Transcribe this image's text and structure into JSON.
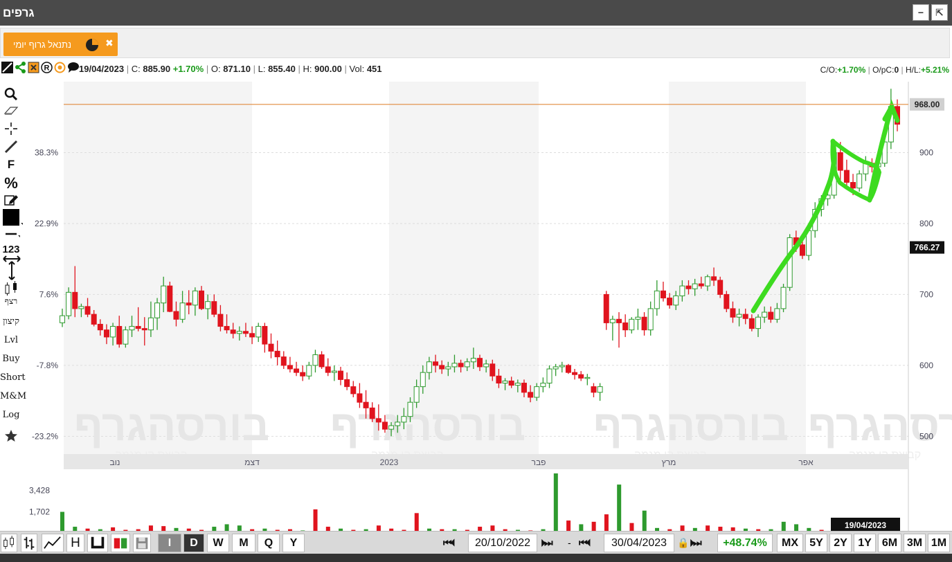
{
  "window": {
    "title": "גרפים",
    "minimize": "−",
    "popout": "⇱"
  },
  "tab": {
    "label": "נתנאל גרוף יומי",
    "icon": "pie-chart-icon",
    "close": "✖"
  },
  "info": {
    "date": "19/04/2023",
    "close_label": "C:",
    "close": "885.90",
    "change": "+1.70%",
    "open_label": "O:",
    "open": "871.10",
    "low_label": "L:",
    "low": "855.40",
    "high_label": "H:",
    "high": "900.00",
    "vol_label": "Vol:",
    "vol": "451",
    "co_label": "C/O:",
    "co": "+1.70%",
    "opc_label": "O/pC:",
    "opc": "0",
    "hl_label": "H/L:",
    "hl": "+5.21%"
  },
  "left_tools": {
    "text_f": "F",
    "percent": "%",
    "numbers": "123",
    "rescale": "רצף",
    "kitzon": "קיצון",
    "lvl": "Lvl",
    "buy": "Buy",
    "short": "Short",
    "mm": "M&M",
    "log": "Log"
  },
  "chart_data": {
    "type": "candlestick",
    "y_ticks": [
      500,
      600,
      700,
      800,
      900
    ],
    "ylim": [
      475,
      1000
    ],
    "y_tick_labels": [
      "500",
      "600",
      "700",
      "800",
      "900"
    ],
    "pct_ticks": [
      "38.3%",
      "22.9%",
      "7.6%",
      "-7.8%",
      "-23.2%"
    ],
    "month_labels": [
      "נוב",
      "דצמ",
      "2023",
      "פבר",
      "מרץ",
      "אפר"
    ],
    "price_line": {
      "value": 968,
      "label": "968.00",
      "color": "#e08a3c"
    },
    "cursor_price": {
      "value": 766.27,
      "label": "766.27"
    },
    "volume_ticks": [
      "3,428",
      "1,702"
    ],
    "cursor_date": "19/04/2023",
    "watermark": "בורסהגרף",
    "watermark_sub": "קבוצת קו מגמה",
    "up_color": "#2e9a2e",
    "down_color": "#e0141e",
    "candles": [
      [
        660,
        680,
        654,
        670
      ],
      [
        670,
        710,
        665,
        703
      ],
      [
        703,
        740,
        668,
        680
      ],
      [
        680,
        687,
        668,
        683
      ],
      [
        683,
        695,
        668,
        672
      ],
      [
        672,
        678,
        655,
        658
      ],
      [
        658,
        665,
        642,
        650
      ],
      [
        650,
        658,
        630,
        640
      ],
      [
        640,
        660,
        628,
        655
      ],
      [
        655,
        670,
        625,
        630
      ],
      [
        630,
        655,
        625,
        650
      ],
      [
        650,
        670,
        640,
        655
      ],
      [
        655,
        682,
        648,
        652
      ],
      [
        652,
        668,
        628,
        650
      ],
      [
        650,
        690,
        640,
        667
      ],
      [
        667,
        695,
        650,
        688
      ],
      [
        688,
        725,
        675,
        712
      ],
      [
        712,
        718,
        675,
        676
      ],
      [
        676,
        690,
        655,
        665
      ],
      [
        665,
        705,
        660,
        688
      ],
      [
        688,
        706,
        672,
        685
      ],
      [
        685,
        710,
        670,
        705
      ],
      [
        705,
        712,
        678,
        680
      ],
      [
        680,
        700,
        665,
        690
      ],
      [
        690,
        700,
        668,
        672
      ],
      [
        672,
        685,
        648,
        655
      ],
      [
        655,
        672,
        645,
        650
      ],
      [
        650,
        660,
        638,
        645
      ],
      [
        645,
        655,
        635,
        648
      ],
      [
        648,
        660,
        640,
        645
      ],
      [
        645,
        655,
        630,
        640
      ],
      [
        640,
        660,
        633,
        655
      ],
      [
        655,
        660,
        618,
        630
      ],
      [
        630,
        645,
        610,
        620
      ],
      [
        620,
        635,
        600,
        612
      ],
      [
        612,
        620,
        595,
        600
      ],
      [
        600,
        612,
        590,
        595
      ],
      [
        595,
        605,
        585,
        590
      ],
      [
        590,
        600,
        578,
        585
      ],
      [
        585,
        605,
        580,
        600
      ],
      [
        600,
        622,
        590,
        615
      ],
      [
        615,
        620,
        595,
        598
      ],
      [
        598,
        610,
        585,
        590
      ],
      [
        590,
        600,
        578,
        592
      ],
      [
        592,
        598,
        572,
        580
      ],
      [
        580,
        590,
        565,
        570
      ],
      [
        570,
        578,
        555,
        560
      ],
      [
        560,
        575,
        540,
        548
      ],
      [
        548,
        565,
        525,
        540
      ],
      [
        540,
        548,
        520,
        525
      ],
      [
        525,
        545,
        508,
        520
      ],
      [
        520,
        530,
        505,
        510
      ],
      [
        510,
        520,
        500,
        515
      ],
      [
        515,
        530,
        505,
        520
      ],
      [
        520,
        540,
        510,
        528
      ],
      [
        528,
        555,
        520,
        548
      ],
      [
        548,
        580,
        540,
        570
      ],
      [
        570,
        600,
        560,
        590
      ],
      [
        590,
        612,
        580,
        605
      ],
      [
        605,
        615,
        590,
        600
      ],
      [
        600,
        607,
        588,
        595
      ],
      [
        595,
        605,
        585,
        598
      ],
      [
        598,
        615,
        590,
        603
      ],
      [
        603,
        608,
        590,
        598
      ],
      [
        598,
        610,
        592,
        605
      ],
      [
        605,
        625,
        595,
        610
      ],
      [
        610,
        615,
        592,
        598
      ],
      [
        598,
        608,
        590,
        602
      ],
      [
        602,
        608,
        578,
        585
      ],
      [
        585,
        595,
        568,
        575
      ],
      [
        575,
        582,
        565,
        578
      ],
      [
        578,
        584,
        568,
        572
      ],
      [
        572,
        580,
        562,
        575
      ],
      [
        575,
        580,
        555,
        562
      ],
      [
        562,
        572,
        548,
        555
      ],
      [
        555,
        575,
        550,
        570
      ],
      [
        570,
        583,
        562,
        575
      ],
      [
        575,
        600,
        568,
        595
      ],
      [
        595,
        602,
        585,
        598
      ],
      [
        598,
        605,
        590,
        600
      ],
      [
        600,
        602,
        588,
        590
      ],
      [
        590,
        595,
        580,
        587
      ],
      [
        587,
        592,
        578,
        582
      ],
      [
        582,
        588,
        572,
        583
      ],
      [
        570,
        575,
        555,
        562
      ],
      [
        562,
        575,
        550,
        570
      ],
      [
        700,
        705,
        650,
        660
      ],
      [
        660,
        670,
        635,
        665
      ],
      [
        665,
        675,
        625,
        660
      ],
      [
        660,
        672,
        640,
        650
      ],
      [
        650,
        668,
        645,
        665
      ],
      [
        665,
        680,
        650,
        668
      ],
      [
        668,
        675,
        642,
        650
      ],
      [
        650,
        690,
        642,
        680
      ],
      [
        680,
        720,
        670,
        705
      ],
      [
        705,
        718,
        690,
        695
      ],
      [
        695,
        702,
        680,
        685
      ],
      [
        685,
        705,
        678,
        698
      ],
      [
        698,
        720,
        690,
        712
      ],
      [
        712,
        720,
        700,
        708
      ],
      [
        708,
        722,
        698,
        715
      ],
      [
        715,
        725,
        708,
        712
      ],
      [
        712,
        728,
        705,
        725
      ],
      [
        725,
        738,
        712,
        720
      ],
      [
        720,
        725,
        695,
        700
      ],
      [
        700,
        705,
        675,
        680
      ],
      [
        680,
        690,
        660,
        668
      ],
      [
        668,
        680,
        655,
        672
      ],
      [
        672,
        680,
        658,
        666
      ],
      [
        666,
        672,
        648,
        652
      ],
      [
        652,
        672,
        640,
        668
      ],
      [
        668,
        683,
        660,
        675
      ],
      [
        675,
        683,
        660,
        665
      ],
      [
        665,
        688,
        660,
        680
      ],
      [
        680,
        715,
        675,
        710
      ],
      [
        710,
        785,
        705,
        780
      ],
      [
        780,
        790,
        760,
        770
      ],
      [
        770,
        780,
        750,
        755
      ],
      [
        755,
        795,
        748,
        790
      ],
      [
        790,
        830,
        780,
        820
      ],
      [
        820,
        840,
        810,
        835
      ],
      [
        835,
        860,
        825,
        840
      ],
      [
        840,
        905,
        835,
        900
      ],
      [
        900,
        915,
        860,
        875
      ],
      [
        875,
        890,
        850,
        858
      ],
      [
        858,
        870,
        840,
        850
      ],
      [
        850,
        875,
        845,
        870
      ],
      [
        870,
        895,
        860,
        885
      ],
      [
        885,
        892,
        872,
        880
      ],
      [
        880,
        895,
        865,
        885
      ],
      [
        885,
        920,
        880,
        915
      ],
      [
        915,
        990,
        905,
        965
      ],
      [
        965,
        975,
        930,
        940
      ]
    ],
    "volumes": [
      [
        1700,
        1
      ],
      [
        500,
        1
      ],
      [
        350,
        0
      ],
      [
        300,
        1
      ],
      [
        450,
        0
      ],
      [
        250,
        0
      ],
      [
        300,
        0
      ],
      [
        600,
        0
      ],
      [
        550,
        0
      ],
      [
        400,
        1
      ],
      [
        350,
        0
      ],
      [
        250,
        0
      ],
      [
        500,
        1
      ],
      [
        700,
        1
      ],
      [
        600,
        1
      ],
      [
        300,
        0
      ],
      [
        350,
        1
      ],
      [
        250,
        0
      ],
      [
        300,
        0
      ],
      [
        200,
        1
      ],
      [
        1900,
        0
      ],
      [
        500,
        0
      ],
      [
        350,
        1
      ],
      [
        250,
        0
      ],
      [
        300,
        1
      ],
      [
        600,
        0
      ],
      [
        350,
        0
      ],
      [
        250,
        0
      ],
      [
        1600,
        0
      ],
      [
        350,
        1
      ],
      [
        300,
        0
      ],
      [
        300,
        1
      ],
      [
        250,
        0
      ],
      [
        500,
        0
      ],
      [
        600,
        0
      ],
      [
        300,
        0
      ],
      [
        250,
        1
      ],
      [
        200,
        0
      ],
      [
        300,
        1
      ],
      [
        4800,
        1
      ],
      [
        1000,
        0
      ],
      [
        700,
        1
      ],
      [
        900,
        0
      ],
      [
        1500,
        0
      ],
      [
        3900,
        1
      ],
      [
        800,
        0
      ],
      [
        1800,
        1
      ],
      [
        400,
        1
      ],
      [
        300,
        0
      ],
      [
        600,
        0
      ],
      [
        400,
        1
      ],
      [
        600,
        0
      ],
      [
        500,
        0
      ],
      [
        450,
        0
      ],
      [
        350,
        1
      ],
      [
        300,
        0
      ],
      [
        300,
        1
      ],
      [
        900,
        1
      ],
      [
        700,
        1
      ],
      [
        400,
        1
      ],
      [
        250,
        0
      ],
      [
        300,
        1
      ],
      [
        600,
        1
      ],
      [
        500,
        1
      ],
      [
        400,
        1
      ],
      [
        350,
        0
      ]
    ]
  },
  "bottom": {
    "view_i": "I",
    "view_d": "D",
    "w": "W",
    "m": "M",
    "q": "Q",
    "y": "Y",
    "from_date": "20/10/2022",
    "dash": "-",
    "to_date": "30/04/2023",
    "change": "+48.74%",
    "mx": "MX",
    "y5": "5Y",
    "y2": "2Y",
    "y1": "1Y",
    "m6": "6M",
    "m3": "3M",
    "m1": "1M"
  }
}
